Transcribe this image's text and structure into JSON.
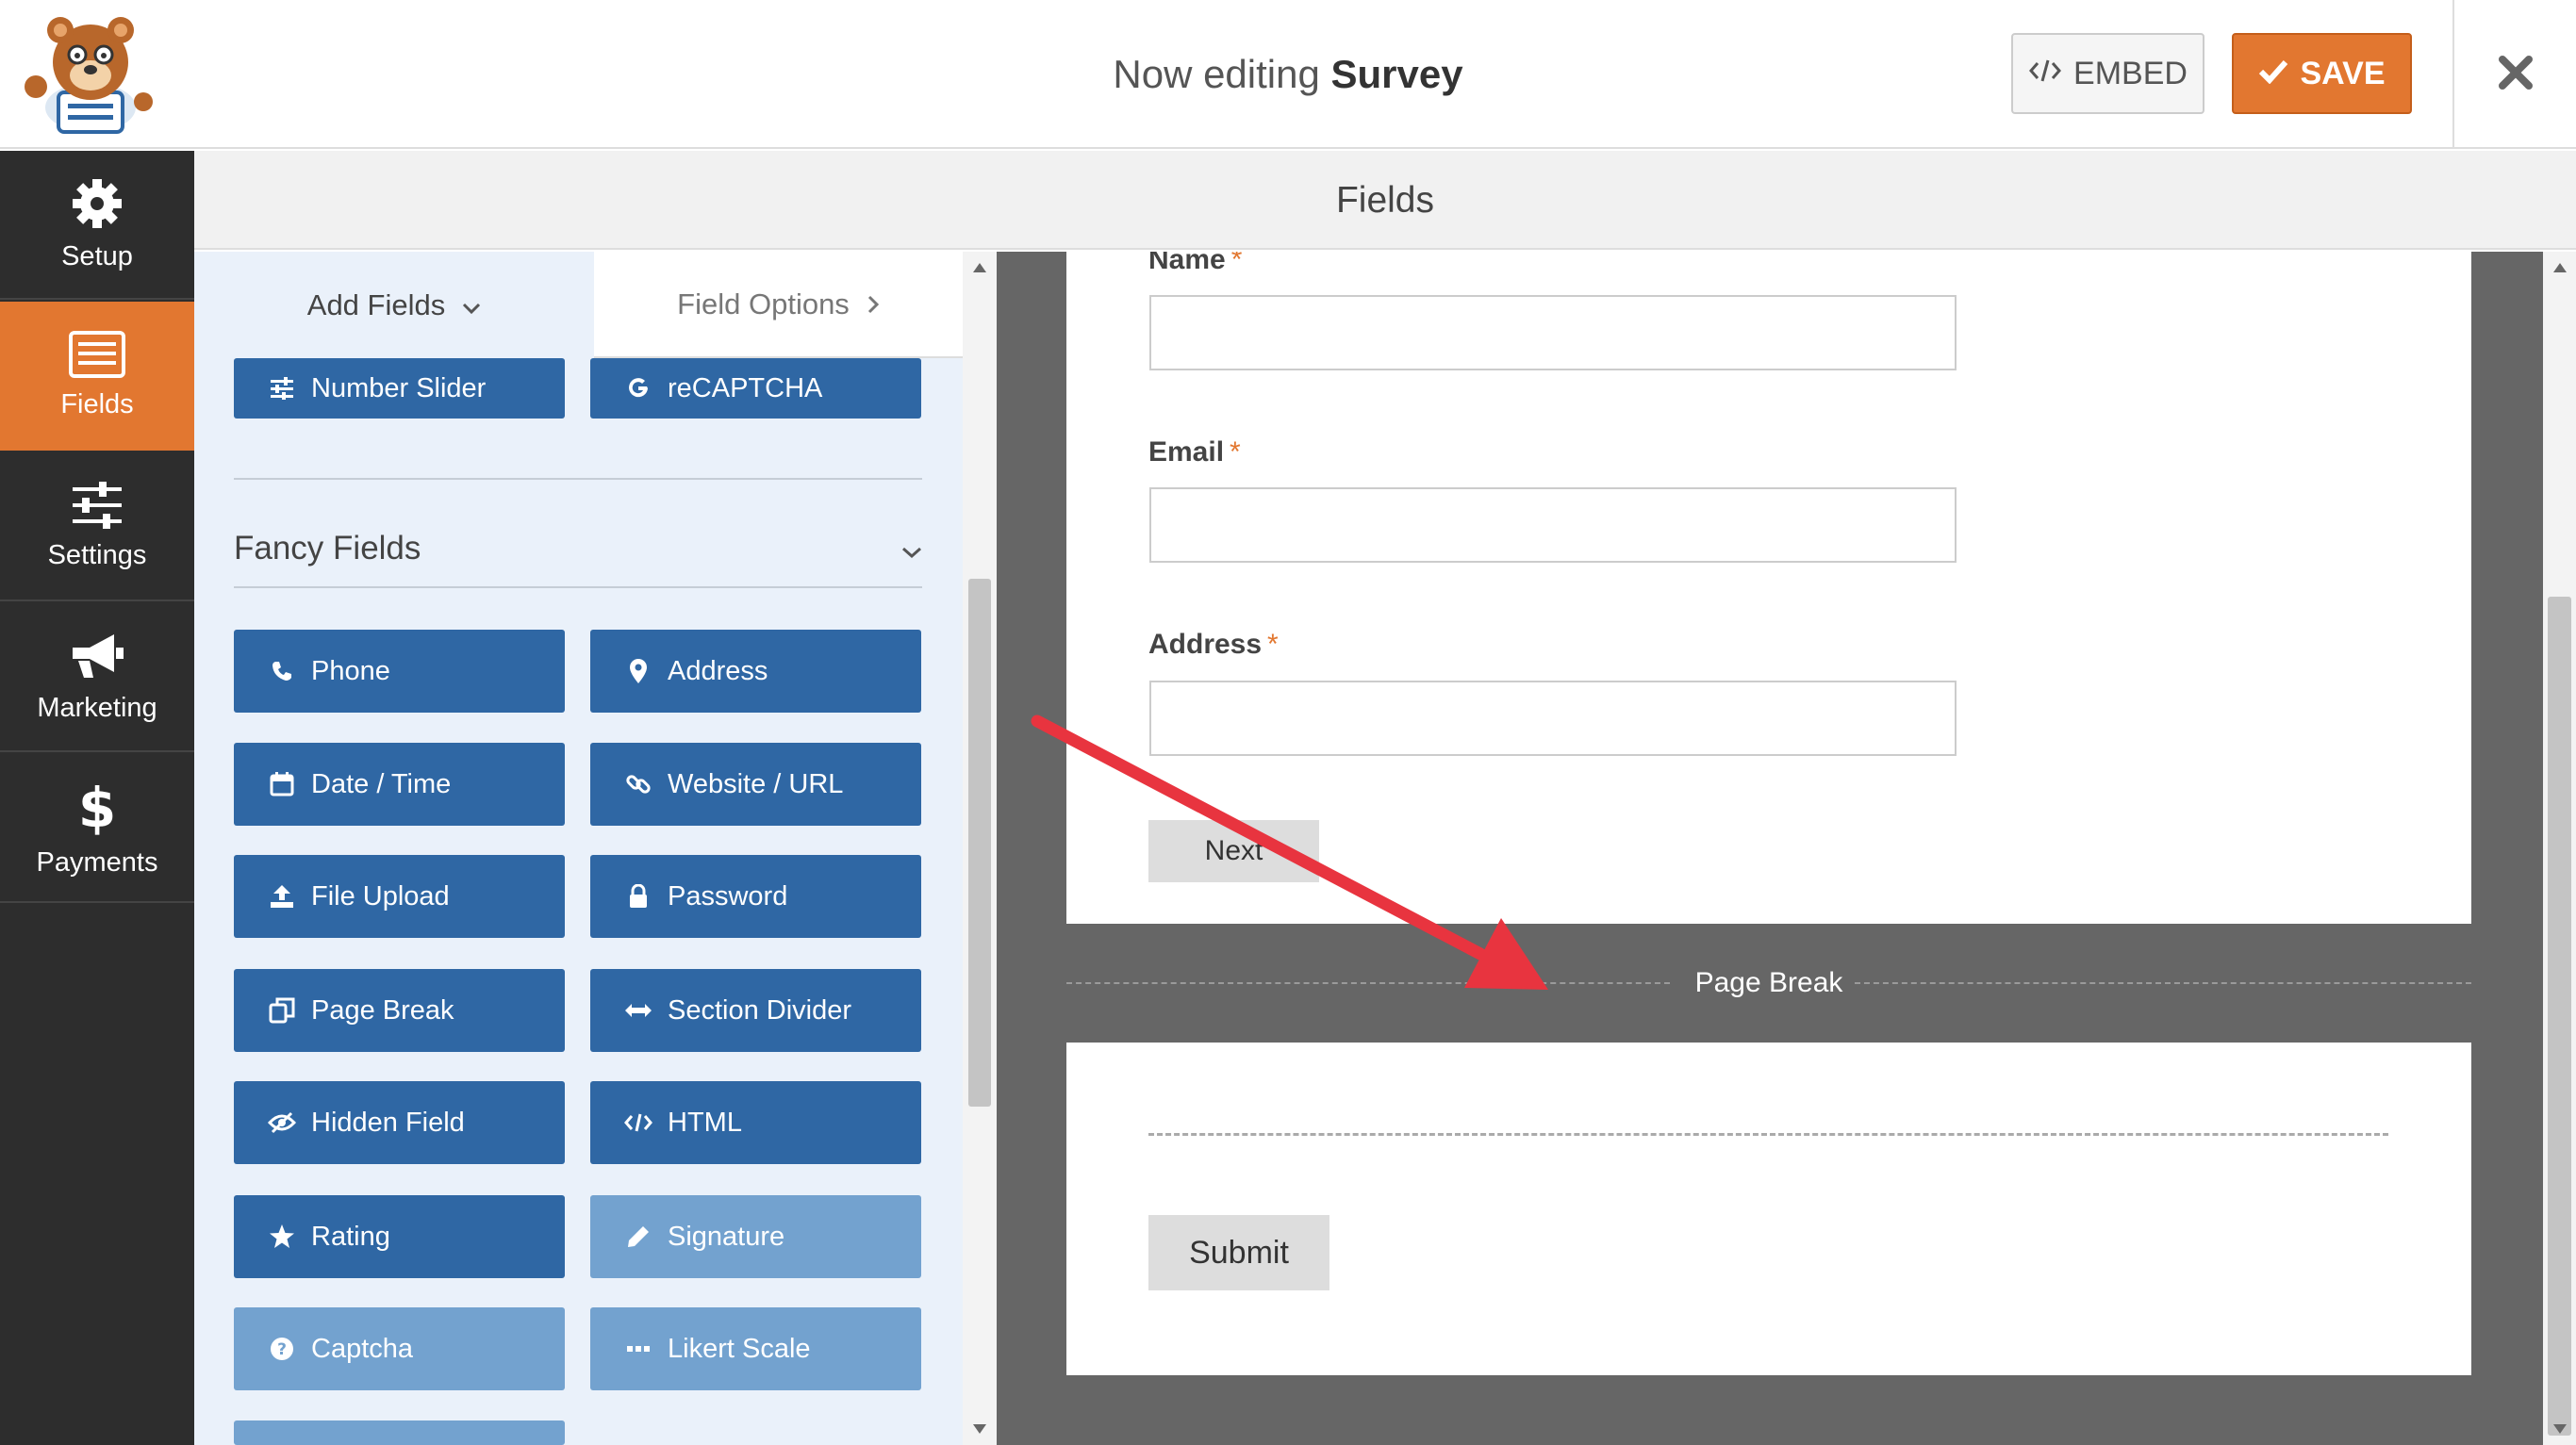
{
  "header": {
    "title_prefix": "Now editing",
    "title_name": "Survey",
    "embed_label": "EMBED",
    "save_label": "SAVE"
  },
  "nav": {
    "setup": "Setup",
    "fields": "Fields",
    "settings": "Settings",
    "marketing": "Marketing",
    "payments": "Payments"
  },
  "section_title": "Fields",
  "panel": {
    "tab_add": "Add Fields",
    "tab_options": "Field Options",
    "top_buttons": [
      "Number Slider",
      "reCAPTCHA"
    ],
    "group_title": "Fancy Fields",
    "fancy_fields": [
      {
        "label": "Phone",
        "icon": "phone-icon"
      },
      {
        "label": "Address",
        "icon": "map-pin-icon"
      },
      {
        "label": "Date / Time",
        "icon": "calendar-icon"
      },
      {
        "label": "Website / URL",
        "icon": "link-icon"
      },
      {
        "label": "File Upload",
        "icon": "upload-icon"
      },
      {
        "label": "Password",
        "icon": "lock-icon"
      },
      {
        "label": "Page Break",
        "icon": "copy-icon"
      },
      {
        "label": "Section Divider",
        "icon": "arrows-h-icon"
      },
      {
        "label": "Hidden Field",
        "icon": "eye-slash-icon"
      },
      {
        "label": "HTML",
        "icon": "code-icon"
      },
      {
        "label": "Rating",
        "icon": "star-icon"
      },
      {
        "label": "Signature",
        "icon": "pencil-icon"
      },
      {
        "label": "Captcha",
        "icon": "question-circle-icon"
      },
      {
        "label": "Likert Scale",
        "icon": "ellipsis-icon"
      }
    ]
  },
  "preview": {
    "fields": [
      "Name",
      "Email",
      "Address"
    ],
    "required_mark": "*",
    "next_label": "Next",
    "page_break_label": "Page Break",
    "submit_label": "Submit"
  },
  "colors": {
    "accent": "#e27730",
    "nav_bg": "#2d2d2d",
    "field_button": "#2f67a4",
    "field_button_disabled": "#73a2cf",
    "annotation_arrow": "#e8343f"
  }
}
